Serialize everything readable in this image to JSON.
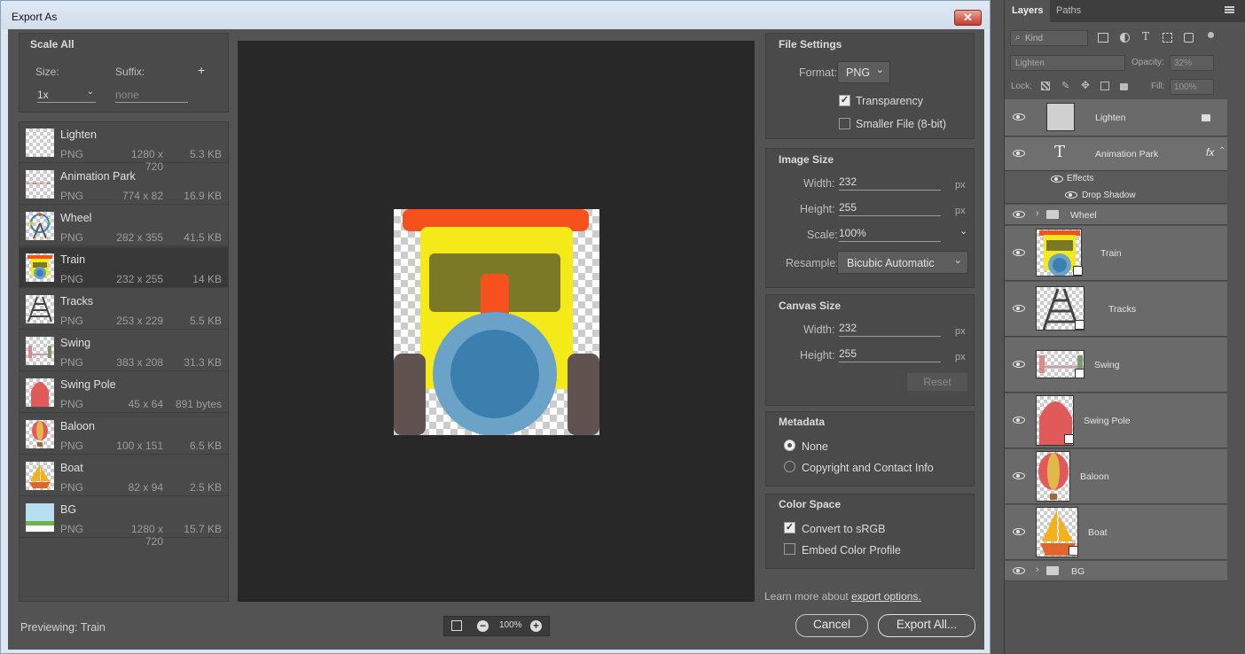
{
  "dialog": {
    "title": "Export As",
    "close_glyph": "✕",
    "scale_all": {
      "heading": "Scale All",
      "size_label": "Size:",
      "suffix_label": "Suffix:",
      "add_glyph": "+",
      "size_value": "1x",
      "suffix_placeholder": "none"
    },
    "assets": [
      {
        "name": "Lighten",
        "format": "PNG",
        "dims": "1280 x 720",
        "size": "5.3 KB"
      },
      {
        "name": "Animation Park",
        "format": "PNG",
        "dims": "774 x 82",
        "size": "16.9 KB"
      },
      {
        "name": "Wheel",
        "format": "PNG",
        "dims": "282 x 355",
        "size": "41.5 KB"
      },
      {
        "name": "Train",
        "format": "PNG",
        "dims": "232 x 255",
        "size": "14 KB"
      },
      {
        "name": "Tracks",
        "format": "PNG",
        "dims": "253 x 229",
        "size": "5.5 KB"
      },
      {
        "name": "Swing",
        "format": "PNG",
        "dims": "383 x 208",
        "size": "31.3 KB"
      },
      {
        "name": "Swing Pole",
        "format": "PNG",
        "dims": "45 x 64",
        "size": "891 bytes"
      },
      {
        "name": "Baloon",
        "format": "PNG",
        "dims": "100 x 151",
        "size": "6.5 KB"
      },
      {
        "name": "Boat",
        "format": "PNG",
        "dims": "82 x 94",
        "size": "2.5 KB"
      },
      {
        "name": "BG",
        "format": "PNG",
        "dims": "1280 x 720",
        "size": "15.7 KB"
      }
    ],
    "selected_asset": "Train",
    "thumb_text_animation_park": "Animation Park",
    "previewing": "Previewing: Train",
    "zoom": "100%",
    "file_settings": {
      "heading": "File Settings",
      "format_label": "Format:",
      "format_value": "PNG",
      "transparency_label": "Transparency",
      "transparency_checked": true,
      "smaller_file_label": "Smaller File (8-bit)",
      "smaller_file_checked": false
    },
    "image_size": {
      "heading": "Image Size",
      "width_label": "Width:",
      "width_value": "232",
      "height_label": "Height:",
      "height_value": "255",
      "scale_label": "Scale:",
      "scale_value": "100%",
      "resample_label": "Resample:",
      "resample_value": "Bicubic Automatic",
      "unit": "px"
    },
    "canvas_size": {
      "heading": "Canvas Size",
      "width_label": "Width:",
      "width_value": "232",
      "height_label": "Height:",
      "height_value": "255",
      "unit": "px",
      "reset_label": "Reset"
    },
    "metadata": {
      "heading": "Metadata",
      "none_label": "None",
      "copyright_label": "Copyright and Contact Info",
      "selected": "None"
    },
    "color_space": {
      "heading": "Color Space",
      "convert_label": "Convert to sRGB",
      "convert_checked": true,
      "embed_label": "Embed Color Profile",
      "embed_checked": false
    },
    "learn_more_prefix": "Learn more about ",
    "learn_more_link": "export options.",
    "cancel_label": "Cancel",
    "export_label": "Export All..."
  },
  "layers_panel": {
    "tabs": [
      "Layers",
      "Paths"
    ],
    "active_tab": "Layers",
    "filter_label": "Kind",
    "blend_mode": "Lighten",
    "opacity_label": "Opacity:",
    "opacity_value": "32%",
    "lock_label": "Lock:",
    "fill_label": "Fill:",
    "fill_value": "100%",
    "layers": [
      {
        "name": "Lighten"
      },
      {
        "name": "Animation Park",
        "fx": "fx",
        "type_glyph": "T"
      },
      {
        "name": "Effects"
      },
      {
        "name": "Drop Shadow"
      },
      {
        "name": "Wheel"
      },
      {
        "name": "Train"
      },
      {
        "name": "Tracks"
      },
      {
        "name": "Swing"
      },
      {
        "name": "Swing Pole"
      },
      {
        "name": "Baloon"
      },
      {
        "name": "Boat"
      },
      {
        "name": "BG"
      }
    ]
  },
  "colors": {
    "train_roof": "#f4511e",
    "train_body": "#f4ea1a",
    "train_window": "#7b7925",
    "train_wheel_outer": "#6ba2c8",
    "train_wheel_inner": "#3b7fae",
    "train_wheels": "#60524f"
  }
}
